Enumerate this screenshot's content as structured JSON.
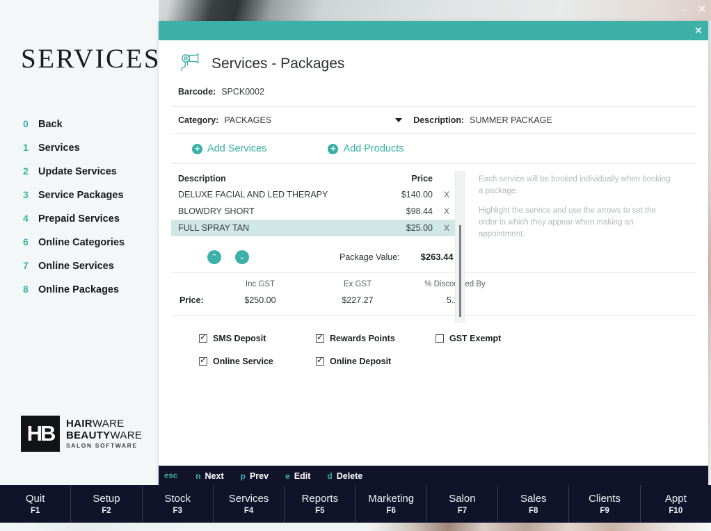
{
  "window": {
    "minimize_label": "–",
    "close_label": "✕"
  },
  "sidebar": {
    "brand": "SERVICES",
    "items": [
      {
        "num": "0",
        "label": "Back"
      },
      {
        "num": "1",
        "label": "Services"
      },
      {
        "num": "2",
        "label": "Update Services"
      },
      {
        "num": "3",
        "label": "Service Packages"
      },
      {
        "num": "4",
        "label": "Prepaid Services"
      },
      {
        "num": "6",
        "label": "Online Categories"
      },
      {
        "num": "7",
        "label": "Online Services"
      },
      {
        "num": "8",
        "label": "Online Packages"
      }
    ],
    "logo": {
      "mark": "HB",
      "line1_bold": "HAIR",
      "line1_thin": "WARE",
      "line2_bold": "BEAUTY",
      "line2_thin": "WARE",
      "line3": "SALON SOFTWARE"
    }
  },
  "dialog": {
    "close_label": "✕",
    "title": "Services - Packages",
    "icon": "hairdryer-icon",
    "barcode_label": "Barcode:",
    "barcode_value": "SPCK0002",
    "category_label": "Category:",
    "category_value": "PACKAGES",
    "description_label": "Description:",
    "description_value": "SUMMER PACKAGE",
    "add_services_label": "Add Services",
    "add_products_label": "Add Products",
    "table": {
      "headers": [
        "Description",
        "Price",
        ""
      ],
      "rows": [
        {
          "description": "DELUXE FACIAL AND LED THERAPY",
          "price": "$140.00",
          "remove": "X",
          "selected": false
        },
        {
          "description": "BLOWDRY SHORT",
          "price": "$98.44",
          "remove": "X",
          "selected": false
        },
        {
          "description": "FULL SPRAY TAN",
          "price": "$25.00",
          "remove": "X",
          "selected": true
        }
      ]
    },
    "help": {
      "paragraph1": "Each service will be booked individually when booking a package.",
      "paragraph2": "Highlight the service and use the arrows to set the order in which they appear when making an appointment."
    },
    "move_up_label": "⌃",
    "move_down_label": "⌄",
    "package_value_label": "Package Value:",
    "package_value": "$263.44",
    "price_label": "Price:",
    "price_columns": [
      "Inc GST",
      "Ex GST",
      "% Discounted By"
    ],
    "price_values": [
      "$250.00",
      "$227.27",
      "5.10"
    ],
    "checkboxes": [
      {
        "label": "SMS Deposit",
        "checked": true
      },
      {
        "label": "Rewards Points",
        "checked": true
      },
      {
        "label": "GST Exempt",
        "checked": false
      },
      {
        "label": "Online Service",
        "checked": true
      },
      {
        "label": "Online Deposit",
        "checked": true
      }
    ],
    "footer": {
      "esc": "esc",
      "actions": [
        {
          "key": "n",
          "label": "Next"
        },
        {
          "key": "p",
          "label": "Prev"
        },
        {
          "key": "e",
          "label": "Edit"
        },
        {
          "key": "d",
          "label": "Delete"
        }
      ]
    }
  },
  "taskbar": [
    {
      "name": "Quit",
      "fkey": "F1"
    },
    {
      "name": "Setup",
      "fkey": "F2"
    },
    {
      "name": "Stock",
      "fkey": "F3"
    },
    {
      "name": "Services",
      "fkey": "F4"
    },
    {
      "name": "Reports",
      "fkey": "F5"
    },
    {
      "name": "Marketing",
      "fkey": "F6"
    },
    {
      "name": "Salon",
      "fkey": "F7"
    },
    {
      "name": "Sales",
      "fkey": "F8"
    },
    {
      "name": "Clients",
      "fkey": "F9"
    },
    {
      "name": "Appt",
      "fkey": "F10"
    }
  ],
  "colors": {
    "accent": "#3db1a8",
    "dark": "#11132a",
    "selection": "#cfe8e5"
  }
}
